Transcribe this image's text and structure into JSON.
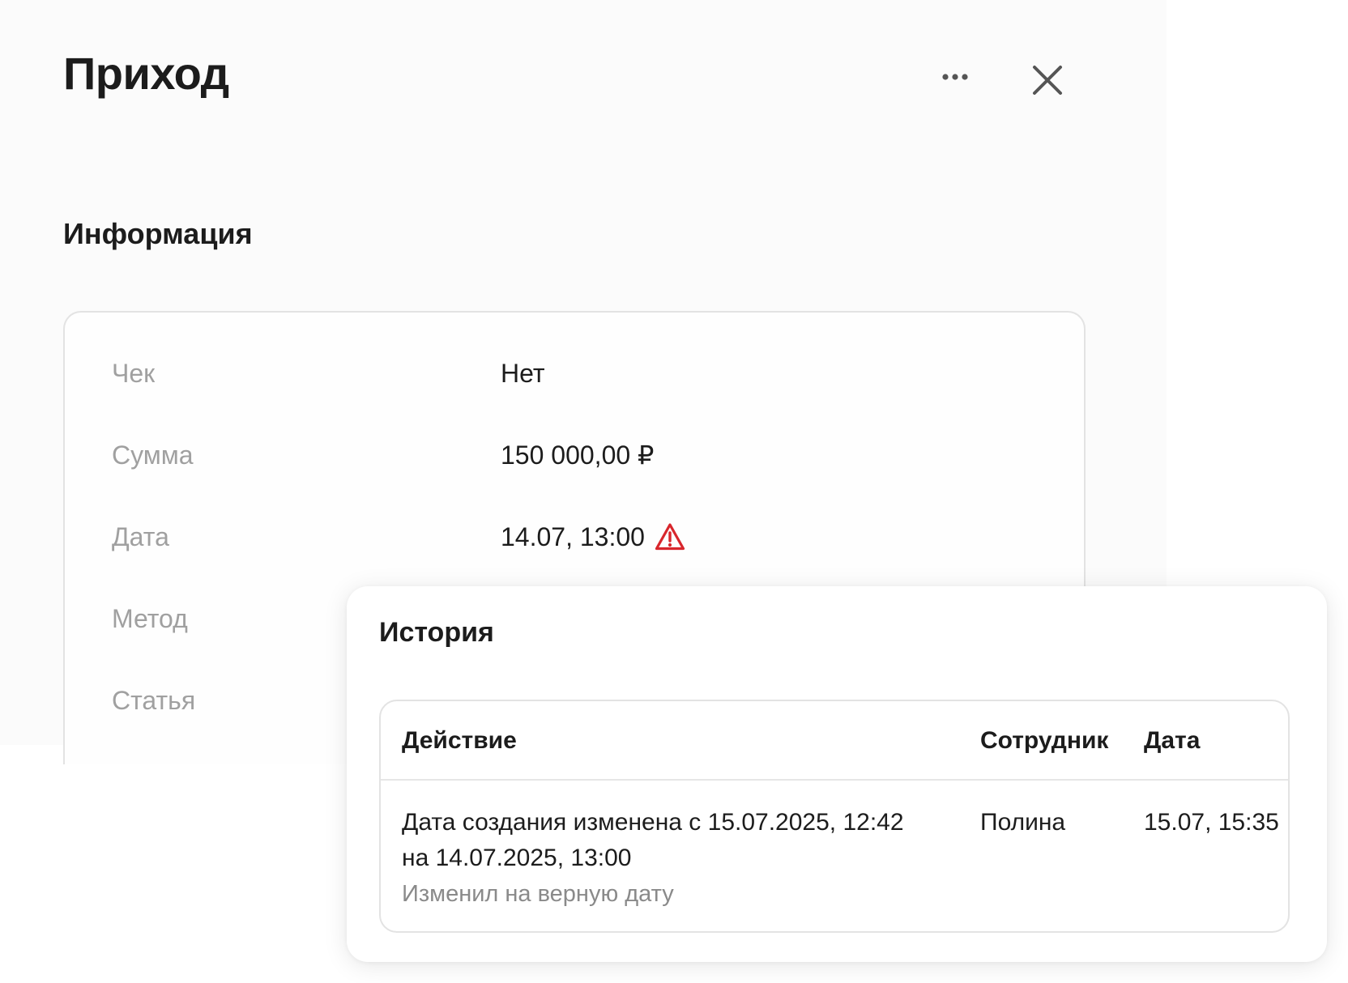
{
  "header": {
    "title": "Приход"
  },
  "icons": {
    "more": "more-horizontal-icon",
    "close": "close-icon",
    "warning": "warning-triangle-icon"
  },
  "colors": {
    "warning": "#d8262c"
  },
  "info": {
    "section_title": "Информация",
    "rows": [
      {
        "label": "Чек",
        "value": "Нет"
      },
      {
        "label": "Сумма",
        "value": "150 000,00 ₽"
      },
      {
        "label": "Дата",
        "value": "14.07, 13:00"
      },
      {
        "label": "Метод",
        "value": ""
      },
      {
        "label": "Статья",
        "value": ""
      }
    ]
  },
  "history": {
    "title": "История",
    "columns": [
      "Действие",
      "Сотрудник",
      "Дата"
    ],
    "rows": [
      {
        "action": "Дата создания изменена с 15.07.2025, 12:42 на 14.07.2025, 13:00",
        "comment": "Изменил на верную дату",
        "user": "Полина",
        "date": "15.07, 15:35"
      }
    ]
  }
}
